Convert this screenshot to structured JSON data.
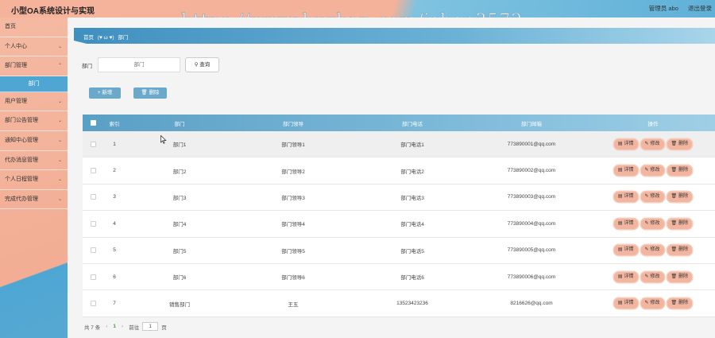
{
  "header": {
    "title": "小型OA系统设计与实现",
    "watermark": "https://www.huzhan.com/ishop3572",
    "user_label": "管理员 abo",
    "logout_label": "退出登录"
  },
  "sidebar": {
    "items": [
      {
        "label": "首页",
        "has_arrow": false
      },
      {
        "label": "个人中心",
        "has_arrow": true
      },
      {
        "label": "部门管理",
        "has_arrow": true
      },
      {
        "label": "部门",
        "sub": true
      },
      {
        "label": "用户管理",
        "has_arrow": true
      },
      {
        "label": "部门公告管理",
        "has_arrow": true
      },
      {
        "label": "通知中心管理",
        "has_arrow": true
      },
      {
        "label": "代办消息管理",
        "has_arrow": true
      },
      {
        "label": "个人日程管理",
        "has_arrow": true
      },
      {
        "label": "完成代办管理",
        "has_arrow": true
      }
    ]
  },
  "breadcrumb": {
    "home": "首页",
    "separator": "(♥ ω ♥)",
    "current": "部门"
  },
  "filter": {
    "label": "部门",
    "placeholder": "部门",
    "query_label": "查询"
  },
  "actions": {
    "add_label": "+ 新增",
    "delete_label": "删除"
  },
  "table": {
    "headers": {
      "index": "索引",
      "dept": "部门",
      "lead": "部门领导",
      "tel": "部门电话",
      "mail": "部门邮箱",
      "ops": "操作"
    },
    "rows": [
      {
        "index": "1",
        "dept": "部门1",
        "lead": "部门领导1",
        "tel": "部门电话1",
        "mail": "773890001@qq.com"
      },
      {
        "index": "2",
        "dept": "部门2",
        "lead": "部门领导2",
        "tel": "部门电话2",
        "mail": "773890002@qq.com"
      },
      {
        "index": "3",
        "dept": "部门3",
        "lead": "部门领导3",
        "tel": "部门电话3",
        "mail": "773890003@qq.com"
      },
      {
        "index": "4",
        "dept": "部门4",
        "lead": "部门领导4",
        "tel": "部门电话4",
        "mail": "773890004@qq.com"
      },
      {
        "index": "5",
        "dept": "部门5",
        "lead": "部门领导5",
        "tel": "部门电话5",
        "mail": "773890005@qq.com"
      },
      {
        "index": "6",
        "dept": "部门6",
        "lead": "部门领导6",
        "tel": "部门电话6",
        "mail": "773890006@qq.com"
      },
      {
        "index": "7",
        "dept": "销售部门",
        "lead": "王五",
        "tel": "13523423236",
        "mail": "8216626@qq.com"
      }
    ],
    "op_labels": {
      "detail": "详情",
      "edit": "修改",
      "delete": "删除"
    }
  },
  "pagination": {
    "total": "共 7 条",
    "current_page": "1",
    "goto_prefix": "前往",
    "goto_value": "1",
    "goto_suffix": "页"
  },
  "colors": {
    "accent_blue": "#4fa6d3",
    "accent_salmon": "#f2b6a0"
  }
}
